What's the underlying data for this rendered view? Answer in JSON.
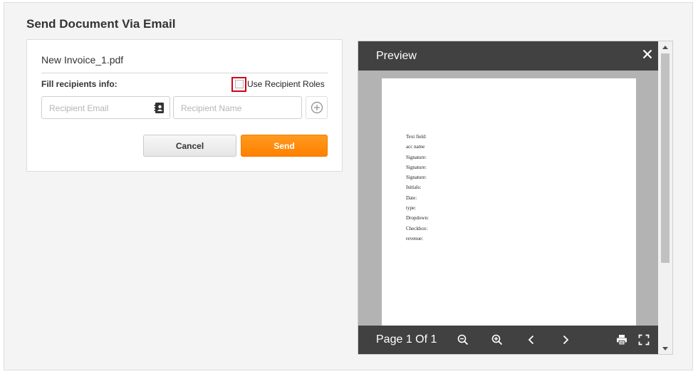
{
  "page": {
    "title": "Send Document Via Email"
  },
  "form": {
    "file_name": "New Invoice_1.pdf",
    "fill_label": "Fill recipients info:",
    "use_roles_label": "Use Recipient Roles",
    "use_roles_checked": false,
    "email_placeholder": "Recipient Email",
    "email_value": "",
    "name_placeholder": "Recipient Name",
    "name_value": "",
    "cancel_label": "Cancel",
    "send_label": "Send",
    "send_color": "#ff8c0a",
    "highlight_color": "#d0021b"
  },
  "preview": {
    "title": "Preview",
    "page_indicator": "Page 1 Of 1",
    "document_fields": [
      "Text field:",
      "acc name",
      "Signature:",
      "Signature:",
      "Signature:",
      "Initials:",
      "Date:",
      "type:",
      "Dropdown:",
      "Checkbox:",
      "revenue:"
    ],
    "toolbar_icons": [
      "zoom-out-icon",
      "zoom-in-icon",
      "previous-page-icon",
      "next-page-icon",
      "print-icon",
      "fullscreen-icon"
    ]
  }
}
